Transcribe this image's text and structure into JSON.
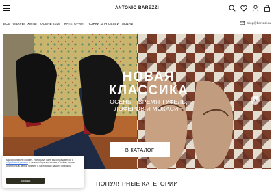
{
  "header": {
    "logo": "ANTONIO BAREZZI",
    "icons": [
      "menu-icon",
      "search-icon",
      "heart-icon",
      "user-icon",
      "bag-icon"
    ]
  },
  "nav": {
    "items": [
      "ВСЕ ТОВАРЫ",
      "ХИТЫ",
      "ОСЕНЬ 2026",
      "КАТЕГОРИИ",
      "ЛОЖКИ ДЛЯ ОБУВИ",
      "АКЦИИ"
    ],
    "email": "shop@barezzi.ru"
  },
  "hero": {
    "title_line1": "НОВАЯ",
    "title_line2": "КЛАССИКА",
    "subtitle_line1": "ОСЕНЬ – ВРЕМЯ ТУФЕЛЬ,",
    "subtitle_line2": "ЛОФЕРОВ И МОКАСИН",
    "cta": "В КАТАЛОГ",
    "next_arrow": "›"
  },
  "cookie": {
    "text_before": "Мы используем cookies. Используя сайт, вы соглашаетесь с ",
    "link": "обработкой данных",
    "text_after": " в целью сбора аналитики. Cookies можно отключить в любой момент в настройках вашего браузера",
    "button": "Хорошо"
  },
  "section": {
    "title": "ПОПУЛЯРНЫЕ КАТЕГОРИИ"
  },
  "colors": {
    "cookie_button": "#2e2e20",
    "link": "#3a6fd8",
    "accent_red": "#8e1b20"
  }
}
